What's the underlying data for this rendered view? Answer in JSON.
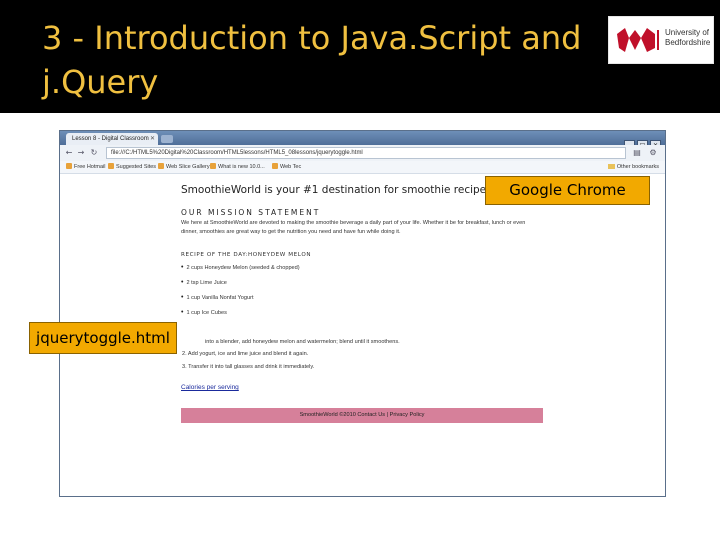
{
  "slide": {
    "title": "3 - Introduction to Java.Script and j.Query",
    "logo_text": "University of Bedfordshire",
    "colors": {
      "title": "#f0c040",
      "header_bg": "#000000",
      "callout_bg": "#f2a900",
      "footer_bg": "#d6809a",
      "link": "#1a2a9c"
    }
  },
  "browser": {
    "tab_label": "Lesson 8 - Digital Classroom",
    "url": "file:///C:/HTML5%20Digital%20Classroom/HTML5lessons/HTML5_08lessons/jquerytoggle.html",
    "bookmarks": [
      {
        "label": "Free Hotmail",
        "icon": "favicon"
      },
      {
        "label": "Suggested Sites",
        "icon": "favicon"
      },
      {
        "label": "Web Slice Gallery",
        "icon": "favicon"
      },
      {
        "label": "What is new 10.0...",
        "icon": "favicon"
      },
      {
        "label": "Web Tec",
        "icon": "favicon"
      }
    ],
    "other_bookmarks": "Other bookmarks"
  },
  "page": {
    "headline": "SmoothieWorld is your #1 destination for smoothie recipes",
    "mission_heading": "OUR MISSION STATEMENT",
    "mission_text": "We here at SmoothieWorld are devoted to making the smoothie beverage a daily part of your life. Whether it be for breakfast, lunch or even dinner, smoothies are great way to get the nutrition you need and have fun while doing it.",
    "recipe_heading": "RECIPE OF THE DAY:HONEYDEW MELON",
    "ingredients": [
      "2 cups Honeydew Melon (seeded & chopped)",
      "2 tsp Lime Juice",
      "1 cup Vanilla Nonfat Yogurt",
      "1 cup Ice Cubes"
    ],
    "step_1": "into a blender, add honeydew melon and watermelon; blend until it smoothens.",
    "step_2": "2.  Add yogurt, ice and lime juice and blend it again.",
    "step_3": "3.  Transfer it into tall glasses and drink it immediately.",
    "calories_link": "Calories per serving",
    "footer": "SmoothieWorld ©2010 Contact Us | Privacy Policy"
  },
  "callouts": {
    "chrome": "Google Chrome",
    "file": "jquerytoggle.html"
  }
}
